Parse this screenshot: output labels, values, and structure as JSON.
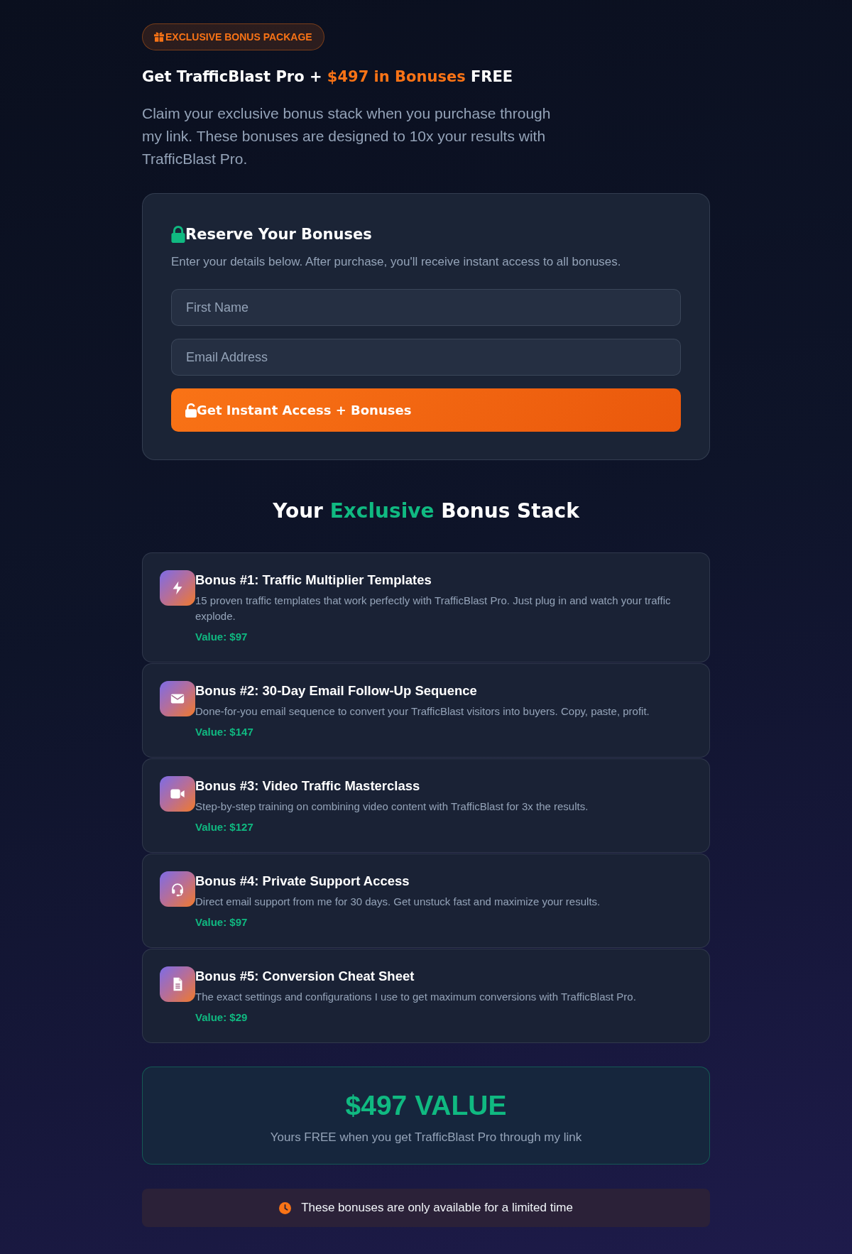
{
  "badge": {
    "label": "EXCLUSIVE BONUS PACKAGE"
  },
  "headline": [
    {
      "text": "Get TrafficBlast Pro + ",
      "highlight": false
    },
    {
      "text": "$497 in Bonuses",
      "highlight": true
    },
    {
      "text": " FREE",
      "highlight": false
    }
  ],
  "intro": "Claim your exclusive bonus stack when you purchase through my link. These bonuses are designed to 10x your results with TrafficBlast Pro.",
  "form": {
    "title": "Reserve Your Bonuses",
    "subtitle": "Enter your details below. After purchase, you'll receive instant access to all bonuses.",
    "fields": [
      {
        "placeholder": "First Name"
      },
      {
        "placeholder": "Email Address"
      }
    ],
    "submit_button": {
      "label": "Get Instant Access + Bonuses"
    }
  },
  "section_heading": [
    {
      "text": "Your ",
      "highlight": false
    },
    {
      "text": "Exclusive",
      "highlight": true
    },
    {
      "text": " Bonus Stack",
      "highlight": false
    }
  ],
  "bonuses": [
    {
      "title": "Bonus #1: Traffic Multiplier Templates",
      "description": "15 proven traffic templates that work perfectly with TrafficBlast Pro. Just plug in and watch your traffic explode.",
      "value": "Value: $97"
    },
    {
      "title": "Bonus #2: 30-Day Email Follow-Up Sequence",
      "description": "Done-for-you email sequence to convert your TrafficBlast visitors into buyers. Copy, paste, profit.",
      "value": "Value: $147"
    },
    {
      "title": "Bonus #3: Video Traffic Masterclass",
      "description": "Step-by-step training on combining video content with TrafficBlast for 3x the results.",
      "value": "Value: $127"
    },
    {
      "title": "Bonus #4: Private Support Access",
      "description": "Direct email support from me for 30 days. Get unstuck fast and maximize your results.",
      "value": "Value: $97"
    },
    {
      "title": "Bonus #5: Conversion Cheat Sheet",
      "description": "The exact settings and configurations I use to get maximum conversions with TrafficBlast Pro.",
      "value": "Value: $29"
    }
  ],
  "total_value": {
    "amount": "$497 VALUE",
    "caption": "Yours FREE when you get TrafficBlast Pro through my link"
  },
  "notice": {
    "text": "These bonuses are only available for a limited time"
  }
}
